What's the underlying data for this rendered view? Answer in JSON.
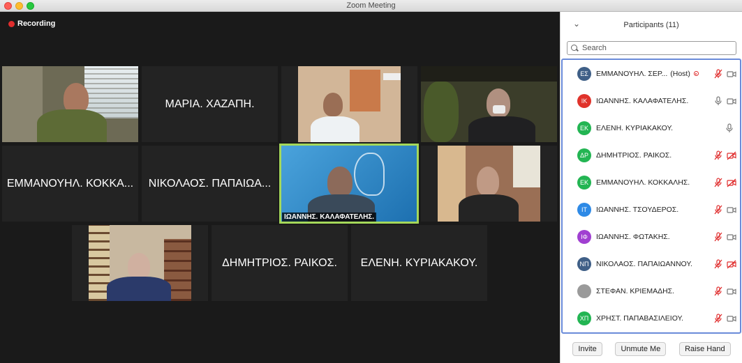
{
  "window": {
    "title": "Zoom Meeting"
  },
  "recording": {
    "label": "Recording"
  },
  "gallery": {
    "tiles": [
      {
        "name": "ΜΑΡΙΑ. ΧΑΖΑΠΗ."
      },
      {
        "name": "ΕΜΜΑΝΟΥΗΛ. ΚΟΚΚΑ..."
      },
      {
        "name": "ΝΙΚΟΛΑΟΣ. ΠΑΠΑΙΩΑ..."
      },
      {
        "name": "ΔΗΜΗΤΡΙΟΣ. ΡΑΙΚΟΣ."
      },
      {
        "name": "ΕΛΕΝΗ. ΚΥΡΙΑΚΑΚΟΥ."
      }
    ],
    "active_speaker_caption": "ΙΩΑΝΝΗΣ. ΚΑΛΑΦΑΤΕΛΗΣ."
  },
  "panel": {
    "title": "Participants (11)",
    "search_placeholder": "Search",
    "participants": [
      {
        "initials": "ΕΣ",
        "name": "ΕΜΜΑΝΟΥΗΛ. ΣΕΡ...",
        "role": "(Host)",
        "color": "#3f5f87",
        "mic": "muted",
        "cam": "on",
        "recording": true
      },
      {
        "initials": "ΙΚ",
        "name": "ΙΩΑΝΝΗΣ. ΚΑΛΑΦΑΤΕΛΗΣ.",
        "color": "#e0332b",
        "mic": "on",
        "cam": "on"
      },
      {
        "initials": "ΕΚ",
        "name": "ΕΛΕΝΗ. ΚΥΡΙΑΚΑΚΟΥ.",
        "color": "#23b553",
        "mic": "on",
        "cam": "none"
      },
      {
        "initials": "ΔΡ",
        "name": "ΔΗΜΗΤΡΙΟΣ. ΡΑΙΚΟΣ.",
        "color": "#23b553",
        "mic": "muted",
        "cam": "off"
      },
      {
        "initials": "ΕΚ",
        "name": "ΕΜΜΑΝΟΥΗΛ. ΚΟΚΚΑΛΗΣ.",
        "color": "#23b553",
        "mic": "muted",
        "cam": "off"
      },
      {
        "initials": "ΙΤ",
        "name": "ΙΩΑΝΝΗΣ. ΤΣΟΥΔΕΡΟΣ.",
        "color": "#2e8ae6",
        "mic": "muted",
        "cam": "on"
      },
      {
        "initials": "ΙΦ",
        "name": "ΙΩΑΝΝΗΣ. ΦΩΤΑΚΗΣ.",
        "color": "#a03fd1",
        "mic": "muted",
        "cam": "on"
      },
      {
        "initials": "ΝΠ",
        "name": "ΝΙΚΟΛΑΟΣ. ΠΑΠΑΙΩΑΝΝΟΥ.",
        "color": "#3f5f87",
        "mic": "muted",
        "cam": "off"
      },
      {
        "initials": "",
        "name": "ΣΤΕΦΑΝ. ΚΡΙΕΜΑΔΗΣ.",
        "color": "#9a9a9a",
        "mic": "muted",
        "cam": "on"
      },
      {
        "initials": "ΧΠ",
        "name": "ΧΡΗΣΤ. ΠΑΠΑΒΑΣΙΛΕΙΟΥ.",
        "color": "#23b553",
        "mic": "muted",
        "cam": "on"
      }
    ],
    "buttons": {
      "invite": "Invite",
      "unmute": "Unmute Me",
      "raise_hand": "Raise Hand"
    }
  }
}
